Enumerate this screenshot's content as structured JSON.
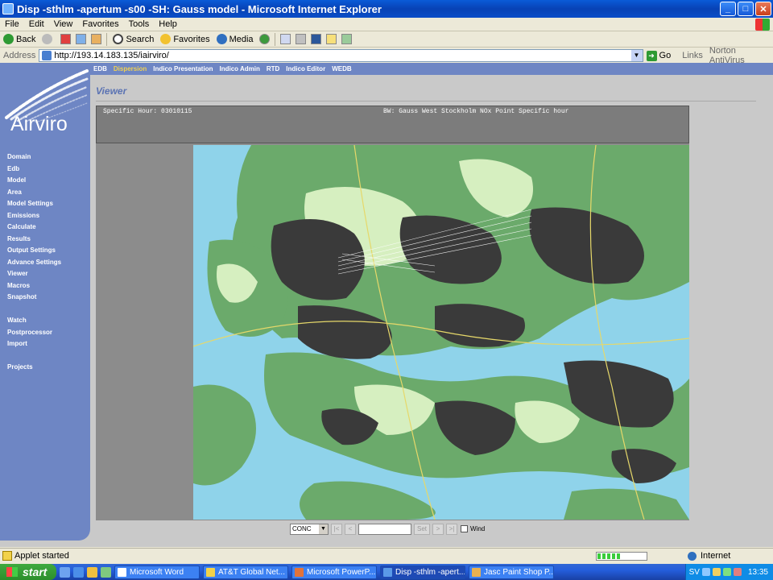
{
  "window": {
    "title": "Disp -sthlm -apertum -s00 -SH: Gauss model - Microsoft Internet Explorer",
    "minimize": "_",
    "maximize": "□",
    "close": "✕"
  },
  "menubar": {
    "items": [
      "File",
      "Edit",
      "View",
      "Favorites",
      "Tools",
      "Help"
    ]
  },
  "toolbar": {
    "back_label": "Back",
    "search_label": "Search",
    "favorites_label": "Favorites",
    "media_label": "Media"
  },
  "addressbar": {
    "label": "Address",
    "url": "http://193.14.183.135/iairviro/",
    "go_label": "Go",
    "links_label": "Links",
    "norton_label": "Norton AntiVirus"
  },
  "topnav": {
    "items": [
      "EDB",
      "Dispersion",
      "Indico Presentation",
      "Indico Admin",
      "RTD",
      "Indico Editor",
      "WEDB"
    ],
    "active": "Dispersion"
  },
  "sidebar": {
    "logo_text": "Airviro",
    "items": [
      "Domain",
      "Edb",
      "Model",
      "Area",
      "Model Settings",
      "Emissions",
      "Calculate",
      "Results",
      "Output Settings",
      "Advance Settings",
      "Viewer",
      "Macros",
      "Snapshot",
      "Watch",
      "Postprocessor",
      "Import",
      "Projects"
    ]
  },
  "main": {
    "title": "Viewer",
    "info_left": "Specific Hour: 03010115",
    "info_right": "BW: Gauss West Stockholm NOx Point Specific hour"
  },
  "controls": {
    "select_value": "CONC",
    "prev_first": "|<",
    "prev": "<",
    "set_label": "Set",
    "next": ">",
    "next_last": ">|",
    "wind_label": "Wind"
  },
  "statusbar": {
    "text": "Applet started",
    "progress_fraction": 0.45,
    "zone": "Internet"
  },
  "taskbar": {
    "start_label": "start",
    "tasks": [
      "Microsoft Word",
      "AT&T Global Net...",
      "Microsoft PowerP...",
      "Disp -sthlm -apert...",
      "Jasc Paint Shop P..."
    ],
    "active_task": "Disp -sthlm -apert...",
    "language": "SV",
    "clock": "13:35"
  },
  "colors": {
    "sidebar": "#6E86C4",
    "active_nav": "#F0D050",
    "water": "#8FD3EA",
    "land_green": "#6BAA6B",
    "land_light": "#D6EFC0",
    "urban": "#3A3A3A"
  }
}
